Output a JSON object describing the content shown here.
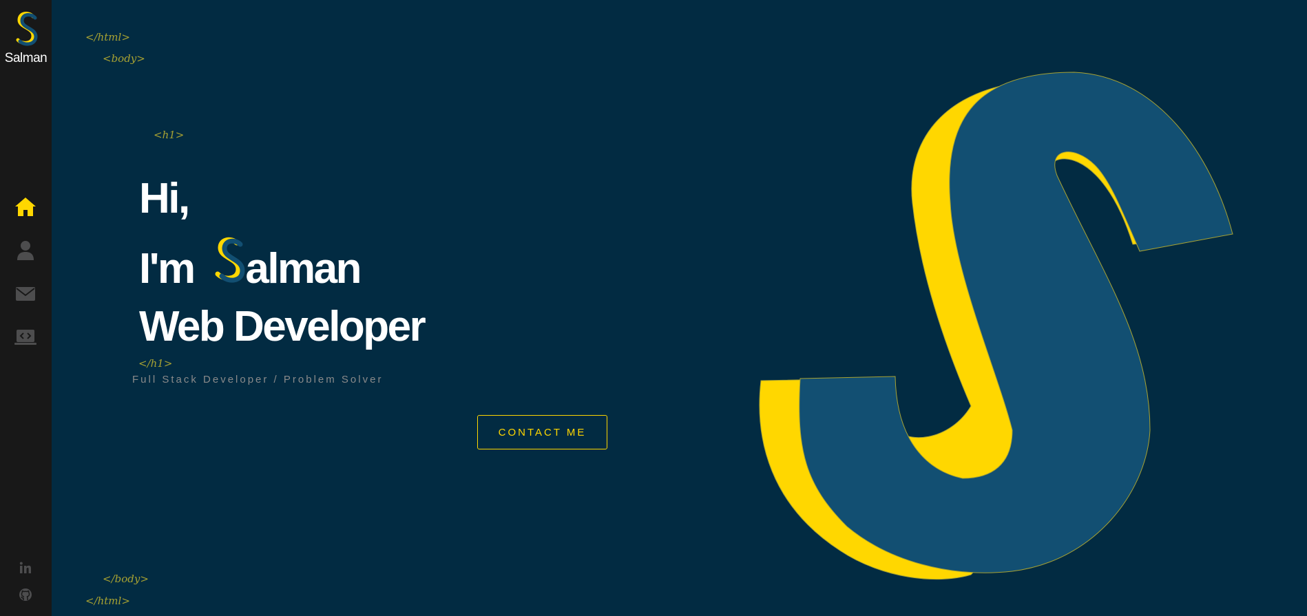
{
  "sidebar": {
    "logo_name": "Salman",
    "nav": [
      {
        "icon": "home-icon",
        "active": true
      },
      {
        "icon": "user-icon",
        "active": false
      },
      {
        "icon": "envelope-icon",
        "active": false
      },
      {
        "icon": "laptop-code-icon",
        "active": false
      }
    ],
    "social": [
      {
        "icon": "linkedin-icon"
      },
      {
        "icon": "github-icon"
      }
    ]
  },
  "tags": {
    "html_open": "</html>",
    "body_open": "<body>",
    "h1_open": "<h1>",
    "h1_close": "</h1>",
    "body_close": "</body>",
    "html_close": "</html>"
  },
  "hero": {
    "line1": "Hi,",
    "line2_prefix": "I'm",
    "line2_logo_letter": "S",
    "line2_rest": "alman",
    "line3": "Web Developer",
    "subtitle": "Full Stack Developer / Problem Solver",
    "cta": "CONTACT ME"
  },
  "colors": {
    "background": "#022b42",
    "sidebar": "#181818",
    "accent": "#ffd700",
    "logo_blue": "#124f72",
    "icon_inactive": "#4d4d4e"
  }
}
